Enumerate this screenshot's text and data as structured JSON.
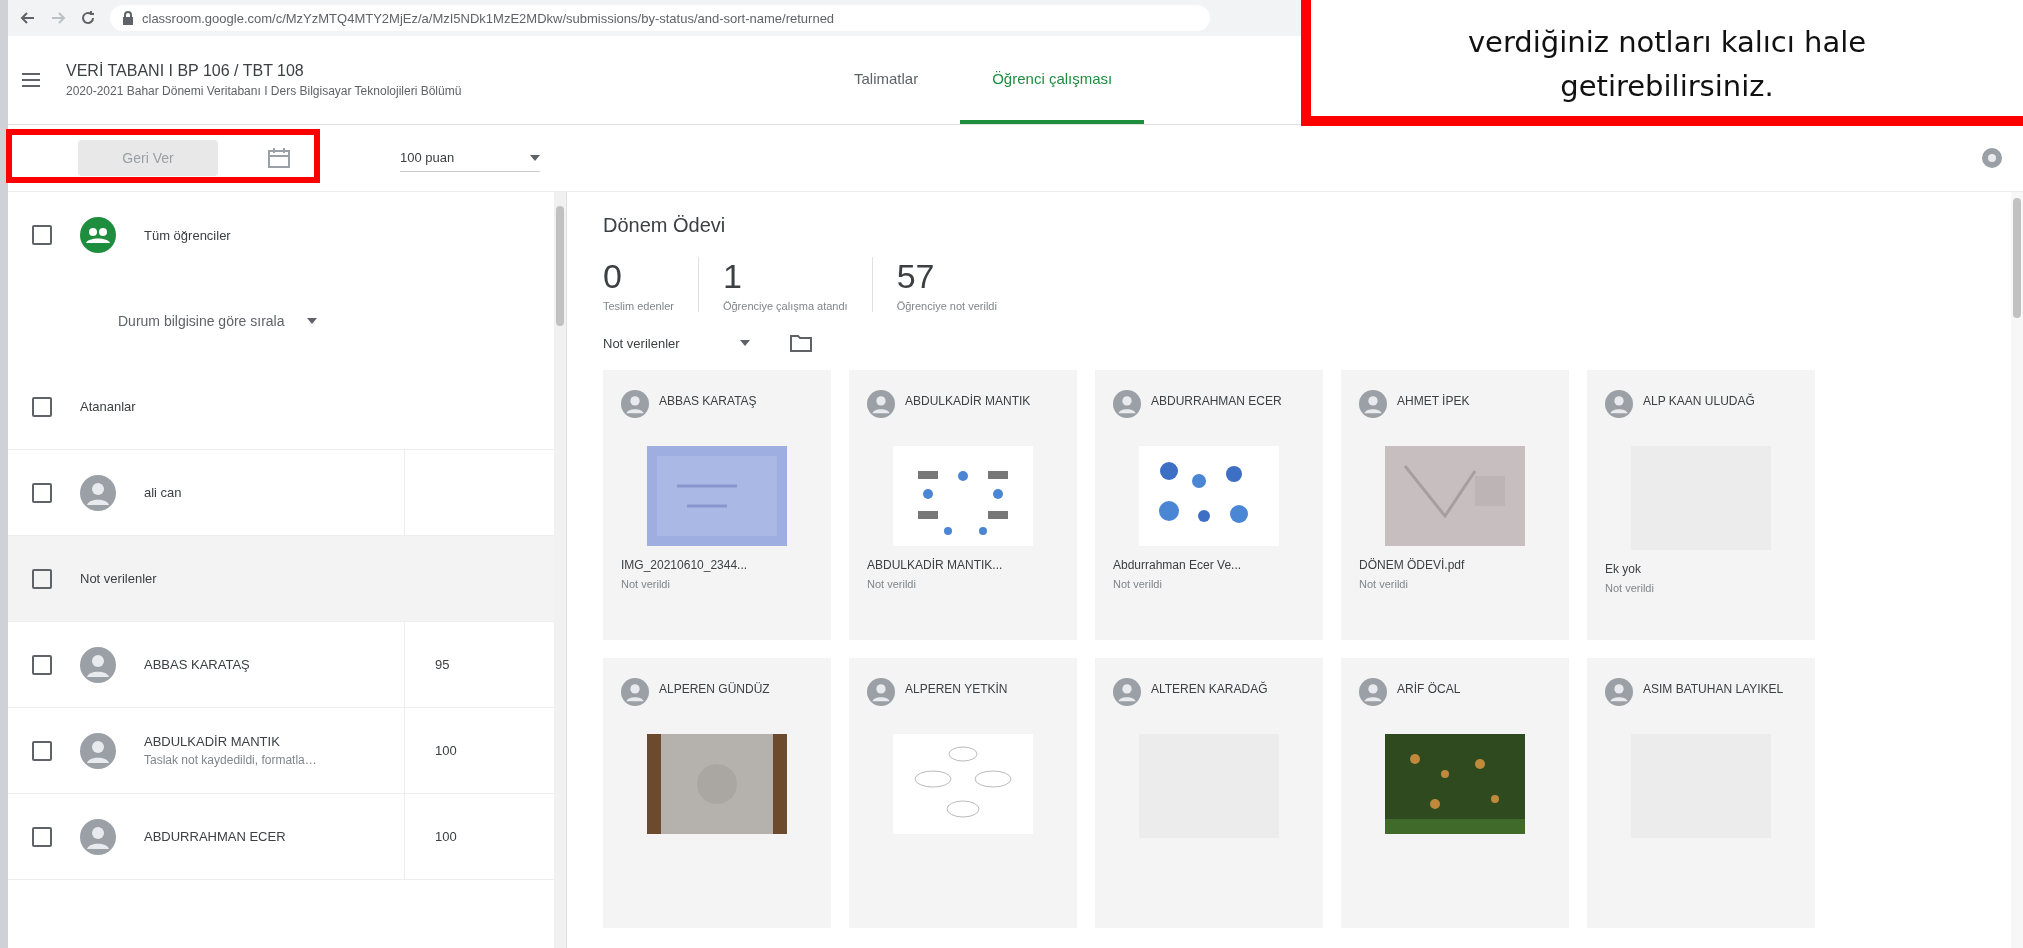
{
  "browser": {
    "url": "classroom.google.com/c/MzYzMTQ4MTY2MjEz/a/MzI5NDk1MzE2MDkw/submissions/by-status/and-sort-name/returned"
  },
  "header": {
    "title": "VERİ TABANI I BP 106 / TBT 108",
    "subtitle": "2020-2021 Bahar Dönemi Veritabanı I Ders Bilgisayar Teknolojileri Bölümü"
  },
  "tabs": [
    {
      "label": "Talimatlar",
      "selected": false
    },
    {
      "label": "Öğrenci çalışması",
      "selected": true
    }
  ],
  "toolbar": {
    "return_button": {
      "label": "Geri Ver",
      "disabled": true
    },
    "points": "100 puan"
  },
  "student_list": {
    "all": {
      "label": "Tüm öğrenciler",
      "checked": false
    },
    "sort": "Durum bilgisine göre sırala",
    "groups": [
      {
        "label": "Atananlar",
        "checked": false,
        "highlighted": false,
        "students": [
          {
            "name": "ali can",
            "checked": false
          }
        ]
      },
      {
        "label": "Not verilenler",
        "checked": false,
        "highlighted": true,
        "students": [
          {
            "name": "ABBAS KARATAŞ",
            "grade": "95",
            "checked": false
          },
          {
            "name": "ABDULKADİR MANTIK",
            "note": "Taslak not kaydedildi, formatla…",
            "grade": "100",
            "checked": false
          },
          {
            "name": "ABDURRAHMAN ECER",
            "grade": "100",
            "checked": false
          }
        ]
      }
    ]
  },
  "work": {
    "title": "Dönem Ödevi",
    "stats": [
      {
        "value": "0",
        "label": "Teslim edenler"
      },
      {
        "value": "1",
        "label": "Öğrenciye çalışma atandı"
      },
      {
        "value": "57",
        "label": "Öğrenciye not verildi"
      }
    ],
    "filter": "Not verilenler",
    "cards": [
      {
        "name": "ABBAS KARATAŞ",
        "file": "IMG_20210610_2344...",
        "status": "Not verildi"
      },
      {
        "name": "ABDULKADİR MANTIK",
        "file": "ABDULKADİR MANTIK...",
        "status": "Not verildi"
      },
      {
        "name": "ABDURRAHMAN ECER",
        "file": "Abdurrahman Ecer Ve...",
        "status": "Not verildi"
      },
      {
        "name": "AHMET İPEK",
        "file": "DÖNEM ÖDEVİ.pdf",
        "status": "Not verildi"
      },
      {
        "name": "ALP KAAN ULUDAĞ",
        "thumbnail": {
          "kind": "empty"
        },
        "file": "Ek yok",
        "status": "Not verildi"
      },
      {
        "name": "ALPEREN GÜNDÜZ"
      },
      {
        "name": "ALPEREN YETKİN"
      },
      {
        "name": "ALTEREN KARADAĞ",
        "thumbnail": {
          "kind": "empty"
        }
      },
      {
        "name": "ARİF ÖCAL"
      },
      {
        "name": "ASIM BATUHAN LAYIKEL",
        "thumbnail": {
          "kind": "empty"
        }
      }
    ]
  },
  "callout": {
    "lines": [
      "verdiğiniz notları kalıcı hale",
      "getirebilirsiniz."
    ]
  }
}
